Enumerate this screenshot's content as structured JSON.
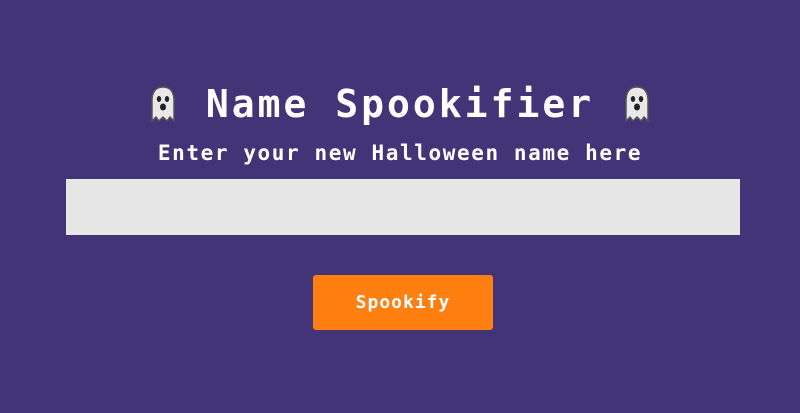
{
  "header": {
    "title": "Name Spookifier",
    "left_icon": "ghost-icon",
    "right_icon": "ghost-icon"
  },
  "form": {
    "prompt": "Enter your new Halloween name here",
    "name_value": "",
    "name_placeholder": "",
    "submit_label": "Spookify"
  },
  "colors": {
    "background": "#433377",
    "input_background": "#e6e6e6",
    "button": "#ff7f11",
    "text": "#ffffff"
  }
}
